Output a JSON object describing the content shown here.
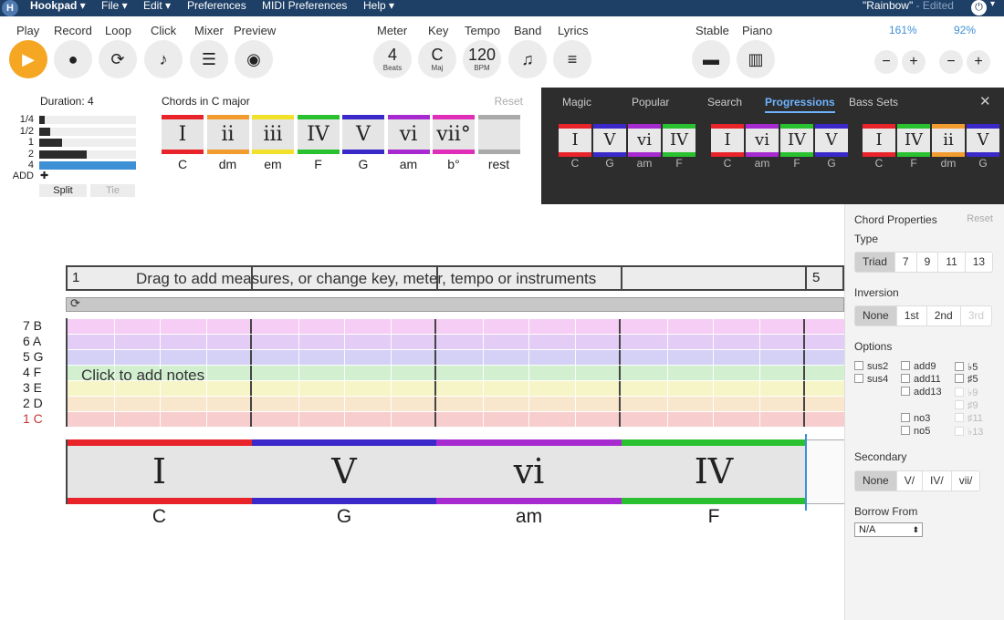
{
  "menubar": {
    "logo": "H",
    "app": "Hookpad",
    "items": [
      "File",
      "Edit",
      "Preferences",
      "MIDI Preferences",
      "Help"
    ],
    "doc_title": "\"Rainbow\"",
    "doc_status": "- Edited",
    "power_icon": "power-icon"
  },
  "toolbar": {
    "play": "Play",
    "record": "Record",
    "loop": "Loop",
    "click": "Click",
    "mixer": "Mixer",
    "preview": "Preview",
    "meter": "Meter",
    "meter_value": "4",
    "meter_unit": "Beats",
    "key": "Key",
    "key_value": "C",
    "key_unit": "Maj",
    "tempo": "Tempo",
    "tempo_value": "120",
    "tempo_unit": "BPM",
    "band": "Band",
    "lyrics": "Lyrics",
    "stable": "Stable",
    "piano": "Piano",
    "zoom1": "161%",
    "zoom2": "92%",
    "minus": "−",
    "plus": "+"
  },
  "duration": {
    "title": "Duration: 4",
    "rows": [
      {
        "label": "1/4",
        "fill": 0.06
      },
      {
        "label": "1/2",
        "fill": 0.11
      },
      {
        "label": "1",
        "fill": 0.24
      },
      {
        "label": "2",
        "fill": 0.49
      },
      {
        "label": "4",
        "fill": 1.0,
        "selected": true
      }
    ],
    "add": "ADD",
    "add_icon": "✚",
    "split": "Split",
    "tie": "Tie"
  },
  "palette": {
    "title": "Chords in C major",
    "reset": "Reset",
    "chords": [
      {
        "numeral": "I",
        "name": "C",
        "color": "#e8232a"
      },
      {
        "numeral": "ii",
        "name": "dm",
        "color": "#f29b2e"
      },
      {
        "numeral": "iii",
        "name": "em",
        "color": "#f2e12a"
      },
      {
        "numeral": "IV",
        "name": "F",
        "color": "#29c12f"
      },
      {
        "numeral": "V",
        "name": "G",
        "color": "#3a28c8"
      },
      {
        "numeral": "vi",
        "name": "am",
        "color": "#a72ad1"
      },
      {
        "numeral": "vii°",
        "name": "b°",
        "color": "#e02eb8"
      },
      {
        "numeral": "",
        "name": "rest",
        "color": "#aaaaaa"
      }
    ]
  },
  "progressions": {
    "tabs": [
      "Magic",
      "Popular",
      "Search",
      "Progressions",
      "Bass Sets"
    ],
    "active_tab": "Progressions",
    "close": "✕",
    "groups": [
      [
        {
          "numeral": "I",
          "name": "C",
          "color": "#e8232a"
        },
        {
          "numeral": "V",
          "name": "G",
          "color": "#3a28c8"
        },
        {
          "numeral": "vi",
          "name": "am",
          "color": "#a72ad1"
        },
        {
          "numeral": "IV",
          "name": "F",
          "color": "#29c12f"
        }
      ],
      [
        {
          "numeral": "I",
          "name": "C",
          "color": "#e8232a"
        },
        {
          "numeral": "vi",
          "name": "am",
          "color": "#a72ad1"
        },
        {
          "numeral": "IV",
          "name": "F",
          "color": "#29c12f"
        },
        {
          "numeral": "V",
          "name": "G",
          "color": "#3a28c8"
        }
      ],
      [
        {
          "numeral": "I",
          "name": "C",
          "color": "#e8232a"
        },
        {
          "numeral": "IV",
          "name": "F",
          "color": "#29c12f"
        },
        {
          "numeral": "ii",
          "name": "dm",
          "color": "#f29b2e"
        },
        {
          "numeral": "V",
          "name": "G",
          "color": "#3a28c8"
        }
      ]
    ]
  },
  "editor": {
    "measure1": "1",
    "measure5": "5",
    "timeline_hint": "Drag to add measures, or change key, meter, tempo or instruments",
    "loop_icon": "loop-icon",
    "click_hint": "Click to add notes",
    "note_rows": [
      {
        "label": "7 B",
        "color": "#f6cdf4"
      },
      {
        "label": "6 A",
        "color": "#e3cdf6"
      },
      {
        "label": "5 G",
        "color": "#d4d0f6"
      },
      {
        "label": "4 F",
        "color": "#d2f0d0"
      },
      {
        "label": "3 E",
        "color": "#f6f5c8"
      },
      {
        "label": "2 D",
        "color": "#f8e6cd"
      },
      {
        "label": "1 C",
        "color": "#f8cdcd",
        "tonic": true
      }
    ],
    "measures": [
      {
        "numeral": "I",
        "name": "C",
        "color": "#e8232a"
      },
      {
        "numeral": "V",
        "name": "G",
        "color": "#3a28c8"
      },
      {
        "numeral": "vi",
        "name": "am",
        "color": "#a72ad1"
      },
      {
        "numeral": "IV",
        "name": "F",
        "color": "#29c12f"
      }
    ]
  },
  "properties": {
    "title": "Chord Properties",
    "reset": "Reset",
    "type_label": "Type",
    "types": [
      "Triad",
      "7",
      "9",
      "11",
      "13"
    ],
    "inversion_label": "Inversion",
    "inversions": [
      "None",
      "1st",
      "2nd",
      "3rd"
    ],
    "options_label": "Options",
    "options_col1": [
      "sus2",
      "sus4"
    ],
    "options_col2": [
      "add9",
      "add11",
      "add13",
      "no3",
      "no5"
    ],
    "options_col3": [
      "♭5",
      "♯5",
      "♭9",
      "♯9",
      "♯11",
      "♭13"
    ],
    "secondary_label": "Secondary",
    "secondaries": [
      "None",
      "V/",
      "IV/",
      "vii/"
    ],
    "borrow_label": "Borrow From",
    "borrow_value": "N/A"
  }
}
